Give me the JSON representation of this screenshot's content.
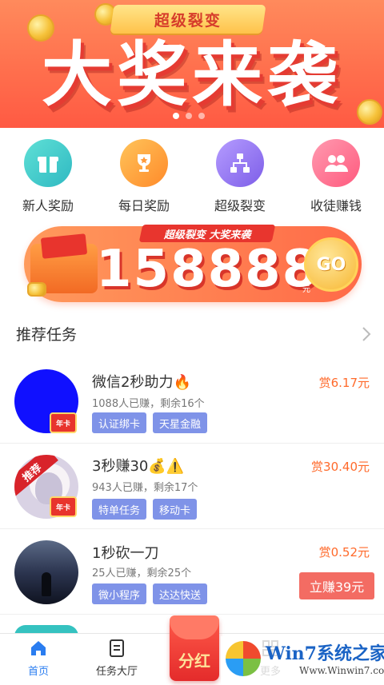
{
  "banner": {
    "ribbon_text": "超级裂变",
    "headline": "大奖来袭",
    "slides": 3,
    "active_slide": 1
  },
  "quick_menu": [
    {
      "label": "新人奖励",
      "icon": "gift-icon",
      "color": "#3fcfc6"
    },
    {
      "label": "每日奖励",
      "icon": "trophy-icon",
      "color": "#ffa63c"
    },
    {
      "label": "超级裂变",
      "icon": "network-icon",
      "color": "#9a7af0"
    },
    {
      "label": "收徒赚钱",
      "icon": "users-icon",
      "color": "#ff6f8e"
    }
  ],
  "promo": {
    "tag": "超级裂变 大奖来袭",
    "amount": "158888",
    "unit": "元",
    "go_label": "GO"
  },
  "section": {
    "title": "推荐任务"
  },
  "tasks": [
    {
      "title": "微信2秒助力🔥",
      "sub": "1088人已赚，剩余16个",
      "tags": [
        "认证绑卡",
        "天星金融"
      ],
      "reward": "赏6.17元",
      "badge": "年卡"
    },
    {
      "title": "3秒赚30💰⚠️",
      "sub": "943人已赚，剩余17个",
      "tags": [
        "特单任务",
        "移动卡"
      ],
      "reward": "赏30.40元",
      "badge": "年卡",
      "ribbon": "推荐"
    },
    {
      "title": "1秒砍一刀",
      "sub": "25人已赚，剩余25个",
      "tags": [
        "微小程序",
        "达达快送"
      ],
      "reward": "赏0.52元",
      "claim": "立赚39元"
    }
  ],
  "nav": {
    "home": "首页",
    "hall": "任务大厅",
    "bonus": "分红",
    "more": "更多"
  },
  "watermark": {
    "name": "Win7系统之家",
    "url": "Www.Winwin7.com"
  },
  "colors": {
    "accent_orange": "#ff6a2b",
    "tag_blue": "#7f93e8",
    "nav_active": "#2a7df0"
  }
}
